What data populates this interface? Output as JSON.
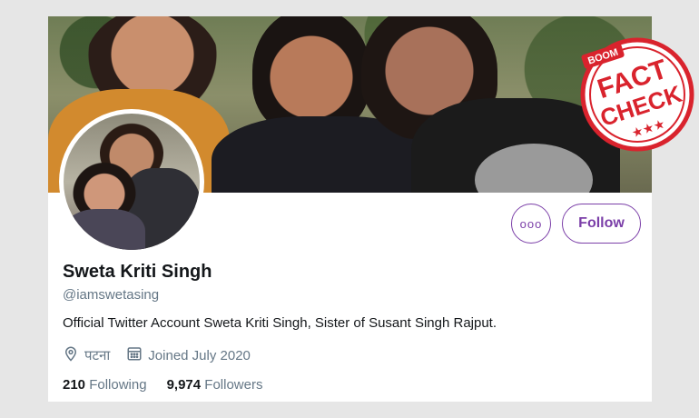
{
  "profile": {
    "name": "Sweta Kriti Singh",
    "handle": "@iamswetasing",
    "bio": "Official Twitter Account Sweta Kriti Singh,  Sister of Susant Singh Rajput.",
    "location": "पटना",
    "joined": "Joined July 2020"
  },
  "stats": {
    "following_count": "210",
    "following_label": "Following",
    "followers_count": "9,974",
    "followers_label": "Followers"
  },
  "buttons": {
    "more": "ooo",
    "follow": "Follow"
  },
  "stamp": {
    "brand": "BOOM",
    "line1": "FACT",
    "line2": "CHECK",
    "stars": "★★★"
  },
  "colors": {
    "accent": "#7b3fa8",
    "stamp_red": "#d9232d"
  }
}
